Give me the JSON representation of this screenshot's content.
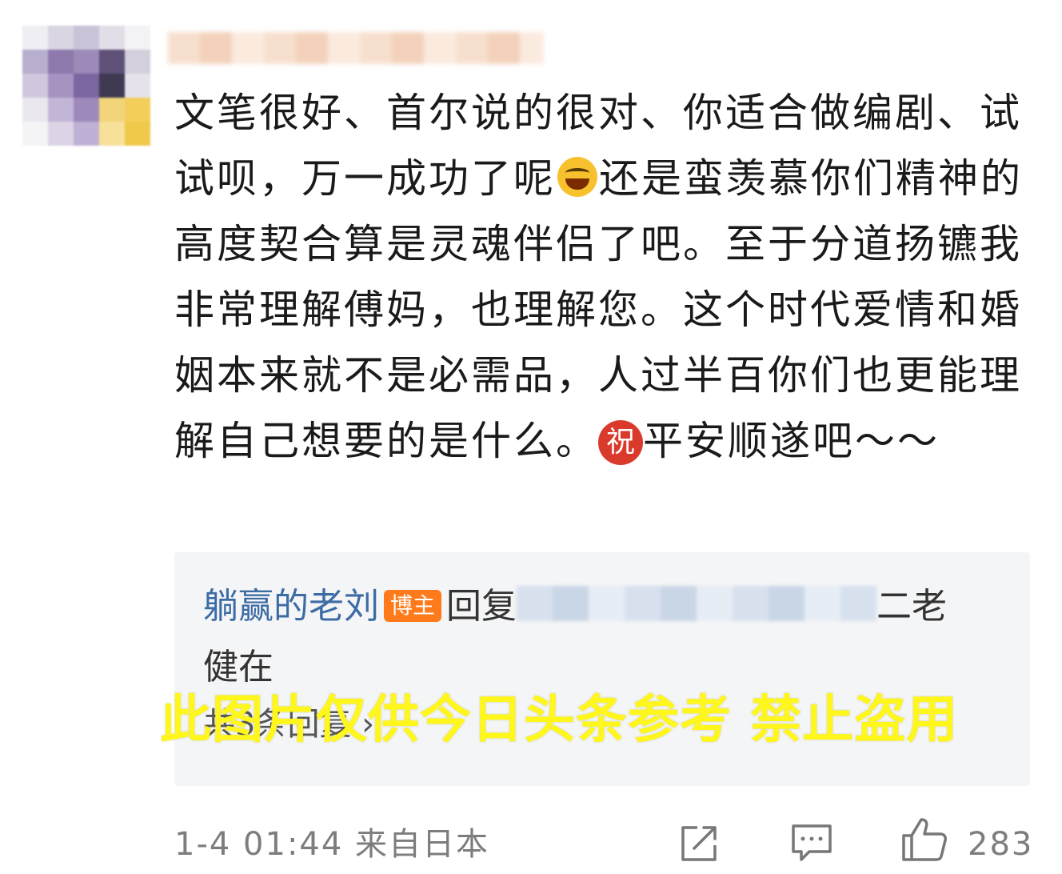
{
  "comment": {
    "part1": "文笔很好、首尔说的很对、你适合做编剧、试试呗，万一成功了呢",
    "part2": "还是蛮羡慕你们精神的高度契合算是灵魂伴侣了吧。至于分道扬镳我非常理解傅妈，也理解您。这个时代爱情和婚姻本来就不是必需品，人过半百你们也更能理解自己想要的是什么。",
    "zhu_emoji_char": "祝",
    "part3": "平安顺遂吧～～",
    "emoji_laugh": "laugh-cry-emoji"
  },
  "reply": {
    "author": "躺赢的老刘",
    "badge": "博主",
    "reply_word": "回复",
    "text_after_name": "二老",
    "text_line2": "健在",
    "view_replies": "共3条回复 ›"
  },
  "watermark": "此图片仅供今日头条参考 禁止盗用",
  "footer": {
    "meta": "1-4 01:44 来自日本",
    "like_count": "283",
    "icons": [
      "share-icon",
      "comment-icon",
      "like-icon"
    ]
  },
  "colors": {
    "author_blue": "#3d6ca5",
    "badge_orange": "#ff7a1a",
    "watermark_yellow": "#fff71c",
    "reply_bg": "#f4f5f6"
  }
}
